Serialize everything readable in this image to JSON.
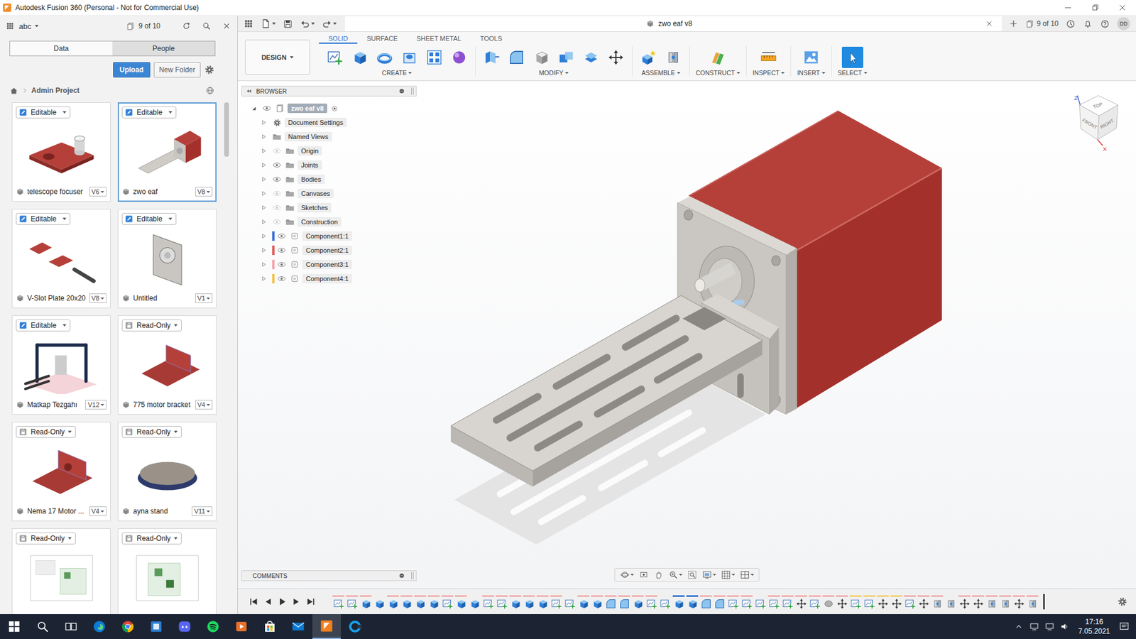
{
  "window": {
    "title": "Autodesk Fusion 360 (Personal - Not for Commercial Use)"
  },
  "data_panel": {
    "project": "abc",
    "count": "9 of 10",
    "tabs": [
      {
        "label": "Data",
        "selected": true
      },
      {
        "label": "People",
        "selected": false
      }
    ],
    "upload": "Upload",
    "new_folder": "New Folder",
    "breadcrumb": "Admin Project",
    "cards": [
      {
        "name": "telescope focuser",
        "version": "V6",
        "access": "Editable",
        "editable": true,
        "selected": false
      },
      {
        "name": "zwo eaf",
        "version": "V8",
        "access": "Editable",
        "editable": true,
        "selected": true
      },
      {
        "name": "V-Slot Plate 20x20",
        "version": "V8",
        "access": "Editable",
        "editable": true,
        "selected": false
      },
      {
        "name": "Untitled",
        "version": "V1",
        "access": "Editable",
        "editable": true,
        "selected": false
      },
      {
        "name": "Matkap Tezgahı",
        "version": "V12",
        "access": "Editable",
        "editable": true,
        "selected": false
      },
      {
        "name": "775 motor bracket",
        "version": "V4",
        "access": "Read-Only",
        "editable": false,
        "selected": false
      },
      {
        "name": "Nema 17 Motor ...",
        "version": "V4",
        "access": "Read-Only",
        "editable": false,
        "selected": false
      },
      {
        "name": "ayna stand",
        "version": "V11",
        "access": "Read-Only",
        "editable": false,
        "selected": false
      },
      {
        "name": "",
        "version": "",
        "access": "Read-Only",
        "editable": false,
        "selected": false
      },
      {
        "name": "",
        "version": "",
        "access": "Read-Only",
        "editable": false,
        "selected": false
      }
    ]
  },
  "document": {
    "title": "zwo eaf v8",
    "count": "9 of 10",
    "user": "DD"
  },
  "ribbon": {
    "workspace": "DESIGN",
    "tabs": [
      {
        "label": "SOLID",
        "selected": true
      },
      {
        "label": "SURFACE",
        "selected": false
      },
      {
        "label": "SHEET METAL",
        "selected": false
      },
      {
        "label": "TOOLS",
        "selected": false
      }
    ],
    "groups": [
      {
        "label": "CREATE",
        "active": false
      },
      {
        "label": "MODIFY",
        "active": false
      },
      {
        "label": "ASSEMBLE",
        "active": false
      },
      {
        "label": "CONSTRUCT",
        "active": false
      },
      {
        "label": "INSPECT",
        "active": false
      },
      {
        "label": "INSERT",
        "active": false
      },
      {
        "label": "SELECT",
        "active": true
      }
    ]
  },
  "browser": {
    "title": "BROWSER",
    "root": {
      "label": "zwo eaf v8",
      "expanded": true,
      "visible": true
    },
    "items": [
      {
        "label": "Document Settings",
        "kind": "settings",
        "expanded": false
      },
      {
        "label": "Named Views",
        "kind": "views",
        "expanded": false
      },
      {
        "label": "Origin",
        "kind": "folder",
        "expanded": false,
        "visible": false
      },
      {
        "label": "Joints",
        "kind": "folder",
        "expanded": false,
        "visible": true
      },
      {
        "label": "Bodies",
        "kind": "folder",
        "expanded": false,
        "visible": true
      },
      {
        "label": "Canvases",
        "kind": "folder",
        "expanded": false,
        "visible": false
      },
      {
        "label": "Sketches",
        "kind": "folder",
        "expanded": false,
        "visible": false
      },
      {
        "label": "Construction",
        "kind": "folder",
        "expanded": false,
        "visible": false
      },
      {
        "label": "Component1:1",
        "kind": "component",
        "expanded": false,
        "visible": true,
        "color": "#3b6fd8"
      },
      {
        "label": "Component2:1",
        "kind": "component",
        "expanded": false,
        "visible": true,
        "color": "#e25b5b"
      },
      {
        "label": "Component3:1",
        "kind": "component",
        "expanded": false,
        "visible": true,
        "color": "#f4a5ad"
      },
      {
        "label": "Component4:1",
        "kind": "component",
        "expanded": false,
        "visible": true,
        "color": "#f3c24c"
      }
    ]
  },
  "viewcube": {
    "faces": [
      "TOP",
      "FRONT",
      "RIGHT"
    ],
    "axes": [
      "Z",
      "X"
    ]
  },
  "comments": {
    "title": "COMMENTS"
  },
  "taskbar": {
    "buttons": [
      {
        "selected": false
      },
      {
        "selected": false
      },
      {
        "selected": false
      },
      {
        "selected": false
      },
      {
        "selected": false
      },
      {
        "selected": false
      },
      {
        "selected": false
      },
      {
        "selected": false
      },
      {
        "selected": false
      },
      {
        "selected": false
      },
      {
        "selected": false
      },
      {
        "selected": true
      },
      {
        "selected": false
      }
    ],
    "time": "17:16",
    "date": "7.05.2021"
  }
}
